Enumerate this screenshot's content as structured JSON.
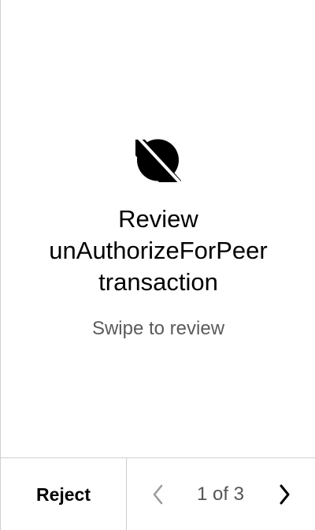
{
  "app_icon": "ontology-logo-icon",
  "review": {
    "title_lines": [
      "Review",
      "unAuthorizeForPeer",
      "transaction"
    ],
    "subtitle": "Swipe to review"
  },
  "footer": {
    "reject_label": "Reject",
    "page_indicator": "1 of 3",
    "prev_icon": "chevron-left-icon",
    "next_icon": "chevron-right-icon"
  },
  "colors": {
    "text": "#000000",
    "subtitle": "#5a5a5a",
    "divider": "#cfcfcf",
    "disabled": "#9a9a9a"
  }
}
